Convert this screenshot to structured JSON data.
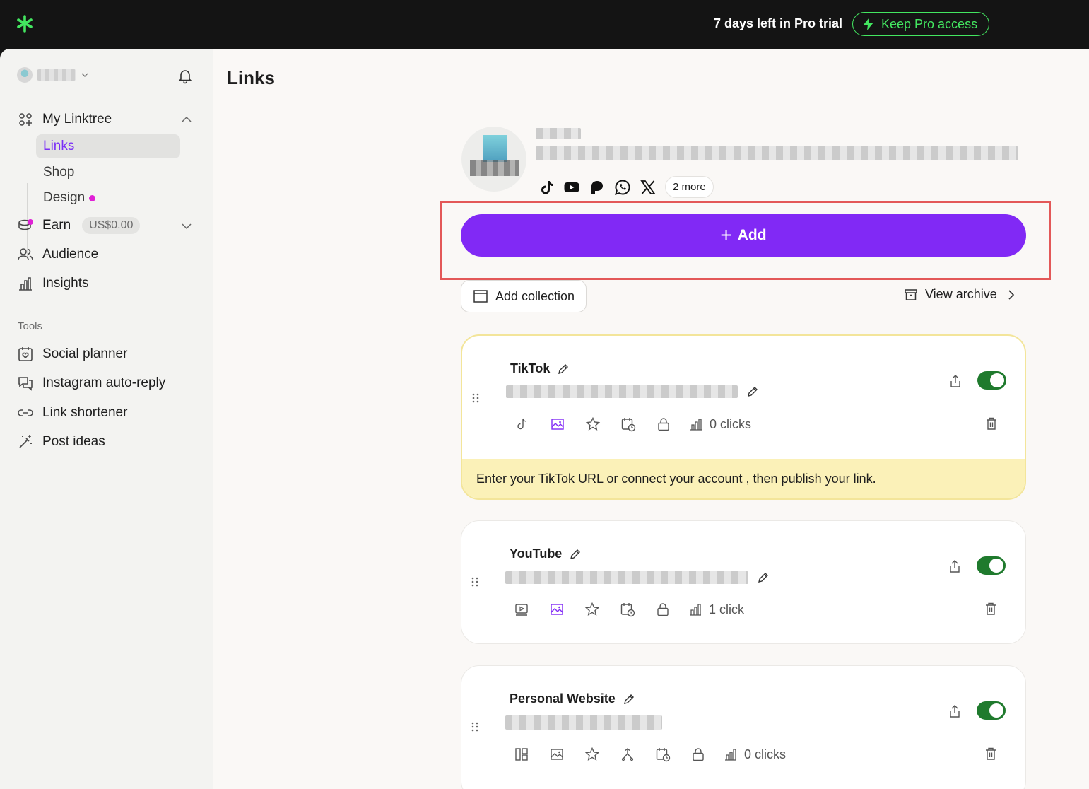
{
  "topbar": {
    "trial_text": "7 days left in Pro trial",
    "pro_button": "Keep Pro access",
    "accent": "#43e660"
  },
  "sidebar": {
    "nav": [
      {
        "label": "My Linktree",
        "icon": "linktree-icon",
        "expanded": true
      },
      {
        "label": "Earn",
        "icon": "coins-icon",
        "badge": "US$0.00"
      },
      {
        "label": "Audience",
        "icon": "people-icon"
      },
      {
        "label": "Insights",
        "icon": "bar-chart-icon"
      }
    ],
    "sub_items": [
      {
        "label": "Links",
        "active": true
      },
      {
        "label": "Shop"
      },
      {
        "label": "Design",
        "dot": true
      }
    ],
    "tools_label": "Tools",
    "tools": [
      {
        "label": "Social planner",
        "icon": "calendar-heart-icon"
      },
      {
        "label": "Instagram auto-reply",
        "icon": "chat-bubbles-icon"
      },
      {
        "label": "Link shortener",
        "icon": "link-icon"
      },
      {
        "label": "Post ideas",
        "icon": "magic-wand-icon"
      }
    ]
  },
  "main": {
    "title": "Links",
    "profile": {
      "more_label": "2 more",
      "social_icons": [
        "tiktok-icon",
        "youtube-icon",
        "patreon-icon",
        "whatsapp-icon",
        "x-icon"
      ]
    },
    "add_button": "Add",
    "add_collection": "Add collection",
    "view_archive": "View archive",
    "brand_purple": "#8129f5"
  },
  "links": [
    {
      "title": "TikTok",
      "clicks": "0 clicks",
      "enabled": true,
      "warning": {
        "before": "Enter your TikTok URL or",
        "link": "connect your account",
        "after": ", then publish your link."
      }
    },
    {
      "title": "YouTube",
      "clicks": "1 click",
      "enabled": true
    },
    {
      "title": "Personal Website",
      "clicks": "0 clicks",
      "enabled": true
    }
  ]
}
